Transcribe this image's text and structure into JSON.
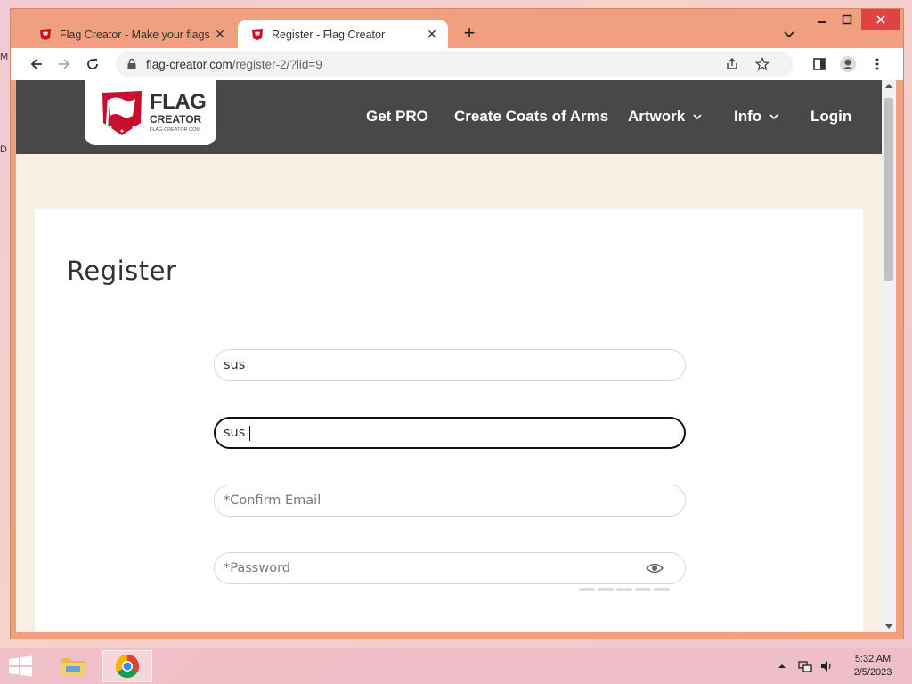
{
  "desktop": {
    "icon_a_label": "M",
    "icon_b_label": "D"
  },
  "browser": {
    "tabs": [
      {
        "title": "Flag Creator - Make your flags",
        "active": false
      },
      {
        "title": "Register - Flag Creator",
        "active": true
      }
    ],
    "new_tab_label": "+",
    "address": {
      "host": "flag-creator.com",
      "path": "/register-2/?lid=9"
    }
  },
  "site": {
    "logo": {
      "line1": "FLAG",
      "line2": "CREATOR",
      "line3": "FLAG-CREATOR.COM"
    },
    "nav": [
      {
        "label": "Get PRO",
        "dropdown": false
      },
      {
        "label": "Create Coats of Arms",
        "dropdown": false
      },
      {
        "label": "Artwork",
        "dropdown": true
      },
      {
        "label": "Info",
        "dropdown": true
      },
      {
        "label": "Login",
        "dropdown": false
      }
    ]
  },
  "form": {
    "heading": "Register",
    "fields": [
      {
        "value": "sus",
        "placeholder": ""
      },
      {
        "value": "sus",
        "placeholder": "",
        "focused": true
      },
      {
        "value": "",
        "placeholder": "*Confirm Email"
      },
      {
        "value": "",
        "placeholder": "*Password"
      }
    ]
  },
  "taskbar": {
    "time": "5:32 AM",
    "date": "2/5/2023"
  },
  "colors": {
    "header": "#484848",
    "page_bg": "#f7efe3",
    "brand_red": "#c8102e",
    "window_frame": "#f0a07e"
  }
}
